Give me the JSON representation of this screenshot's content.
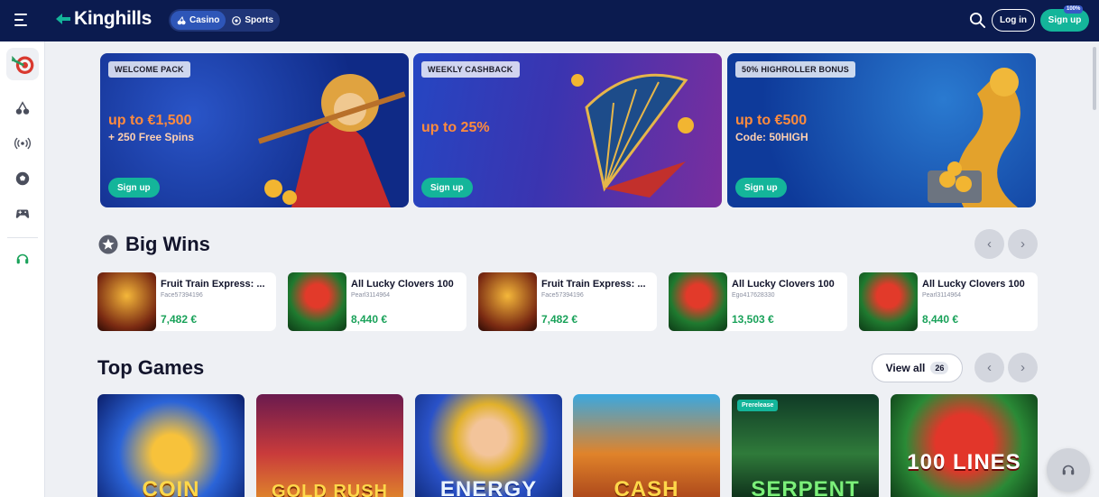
{
  "header": {
    "brand": "Kinghills",
    "tabs": [
      {
        "label": "Casino",
        "active": true
      },
      {
        "label": "Sports",
        "active": false
      }
    ],
    "login_label": "Log in",
    "signup_label": "Sign up",
    "signup_badge": "100%",
    "accent": "#14b59a",
    "bg": "#0b1b4f"
  },
  "sidebar": {
    "items": [
      {
        "icon": "dartboard-icon",
        "active": true
      },
      {
        "icon": "cherries-icon",
        "active": false
      },
      {
        "icon": "live-broadcast-icon",
        "active": false
      },
      {
        "icon": "football-icon",
        "active": false
      },
      {
        "icon": "gamepad-icon",
        "active": false
      },
      {
        "icon": "headset-icon",
        "active": false
      }
    ]
  },
  "banners": [
    {
      "tag": "WELCOME PACK",
      "title": "up to €1,500",
      "subtitle": "+ 250 Free Spins",
      "cta": "Sign up"
    },
    {
      "tag": "WEEKLY CASHBACK",
      "title": "up to 25%",
      "subtitle": "",
      "cta": "Sign up"
    },
    {
      "tag": "50% HIGHROLLER BONUS",
      "title": "up to €500",
      "subtitle": "Code: 50HIGH",
      "cta": "Sign up"
    }
  ],
  "big_wins": {
    "title": "Big Wins",
    "items": [
      {
        "game": "Fruit Train Express: ...",
        "user": "Face57394196",
        "amount": "7,482 €"
      },
      {
        "game": "All Lucky Clovers 100",
        "user": "Pearl3114964",
        "amount": "8,440 €"
      },
      {
        "game": "Fruit Train Express: ...",
        "user": "Face57394196",
        "amount": "7,482 €"
      },
      {
        "game": "All Lucky Clovers 100",
        "user": "Ego417628330",
        "amount": "13,503 €"
      },
      {
        "game": "All Lucky Clovers 100",
        "user": "Pearl3114964",
        "amount": "8,440 €"
      }
    ]
  },
  "top_games": {
    "title": "Top Games",
    "view_all_label": "View all",
    "view_all_count": "26",
    "items": [
      {
        "label": "COIN",
        "badge": ""
      },
      {
        "label": "GOLD RUSH",
        "badge": ""
      },
      {
        "label": "ENERGY",
        "badge": ""
      },
      {
        "label": "CASH",
        "badge": ""
      },
      {
        "label": "SERPENT",
        "badge": "Prerelease"
      },
      {
        "label": "100 LINES",
        "badge": ""
      }
    ]
  }
}
